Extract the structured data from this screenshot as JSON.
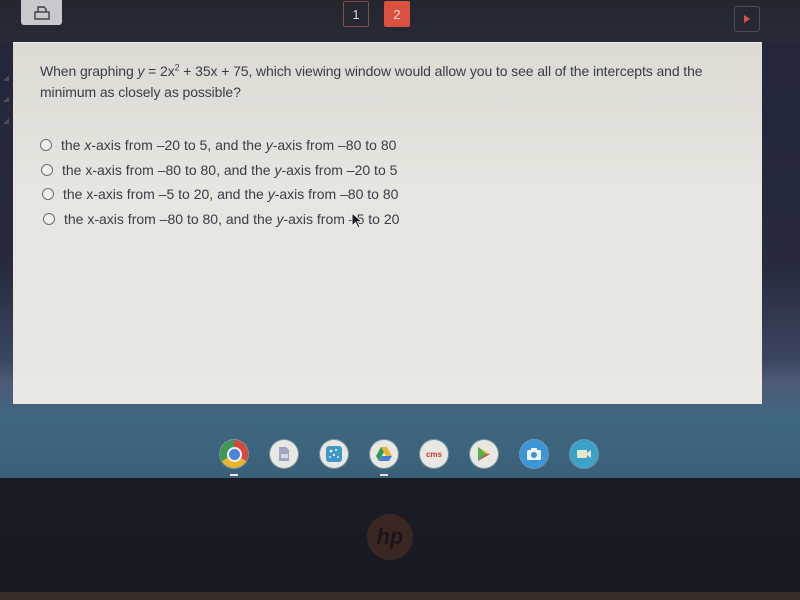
{
  "toolbar": {
    "print_icon": "print-icon",
    "pages": [
      {
        "label": "1",
        "state": "visited"
      },
      {
        "label": "2",
        "state": "current"
      }
    ],
    "next_icon": "triangle-right-icon",
    "accent_color": "#d9513f"
  },
  "question": {
    "prefix": "When graphing ",
    "var_y": "y",
    "eq1": " = 2x",
    "exp": "2",
    "eq2": " + 35x + 75, which viewing window would allow you to see all of the intercepts and the minimum as closely as possible?"
  },
  "choices": [
    {
      "a": "the ",
      "x": "x",
      "b": "-axis from –20 to 5, and the ",
      "y": "y",
      "c": "-axis from –80 to 80",
      "selected": false
    },
    {
      "a": "the ",
      "x": "x",
      "b": "-axis from –80 to 80, and the ",
      "y": "y",
      "c": "-axis from –20 to 5",
      "selected": false
    },
    {
      "a": "the ",
      "x": "x",
      "b": "-axis from –5 to 20, and the ",
      "y": "y",
      "c": "-axis from –80 to 80",
      "selected": false
    },
    {
      "a": "the ",
      "x": "x",
      "b": "-axis from –80 to 80, and the ",
      "y": "y",
      "c": "-axis from –5 to 20",
      "selected": false
    }
  ],
  "shelf": {
    "apps": [
      {
        "name": "chrome",
        "icon": "chrome-icon",
        "running": true
      },
      {
        "name": "docs",
        "icon": "document-icon",
        "running": false
      },
      {
        "name": "app",
        "icon": "dots-app-icon",
        "running": false
      },
      {
        "name": "drive",
        "icon": "google-drive-icon",
        "running": true
      },
      {
        "name": "cms",
        "icon": "cms-icon",
        "label": "cms",
        "running": false
      },
      {
        "name": "play-store",
        "icon": "play-store-icon",
        "running": false
      },
      {
        "name": "camera",
        "icon": "camera-icon",
        "running": false
      },
      {
        "name": "meet",
        "icon": "video-camera-icon",
        "running": false
      }
    ]
  },
  "bezel": {
    "brand": "hp"
  }
}
